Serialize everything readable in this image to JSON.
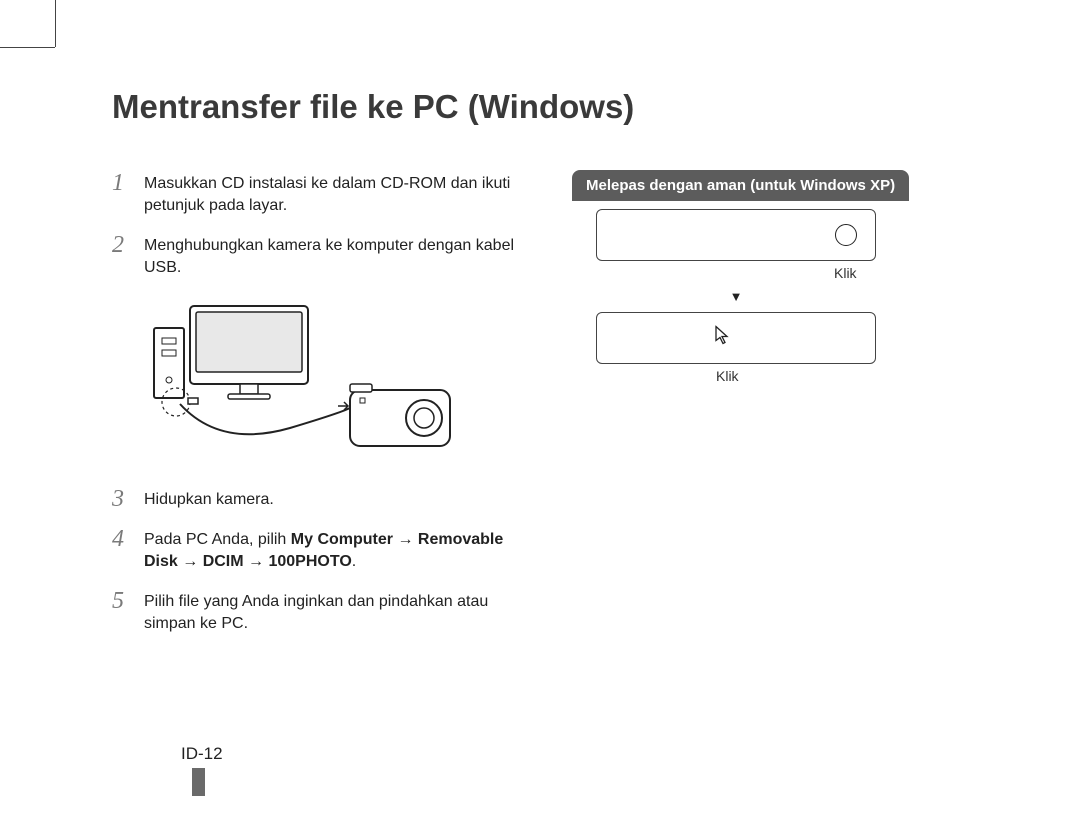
{
  "title": "Mentransfer file ke PC (Windows)",
  "steps": {
    "s1": {
      "num": "1",
      "text": "Masukkan CD instalasi ke dalam CD-ROM dan ikuti petunjuk pada layar."
    },
    "s2": {
      "num": "2",
      "text": "Menghubungkan kamera ke komputer dengan kabel USB."
    },
    "s3": {
      "num": "3",
      "text": "Hidupkan kamera."
    },
    "s4": {
      "num": "4",
      "prefix": "Pada PC Anda, pilih ",
      "bold": "My Computer → Removable Disk → DCIM → 100PHOTO",
      "suffix": "."
    },
    "s5": {
      "num": "5",
      "text": "Pilih file yang Anda inginkan dan pindahkan atau simpan ke PC."
    }
  },
  "sidebar": {
    "heading": "Melepas dengan aman (untuk Windows XP)",
    "klik1": "Klik",
    "klik2": "Klik",
    "arrow": "▼"
  },
  "pageNumber": "ID-12"
}
